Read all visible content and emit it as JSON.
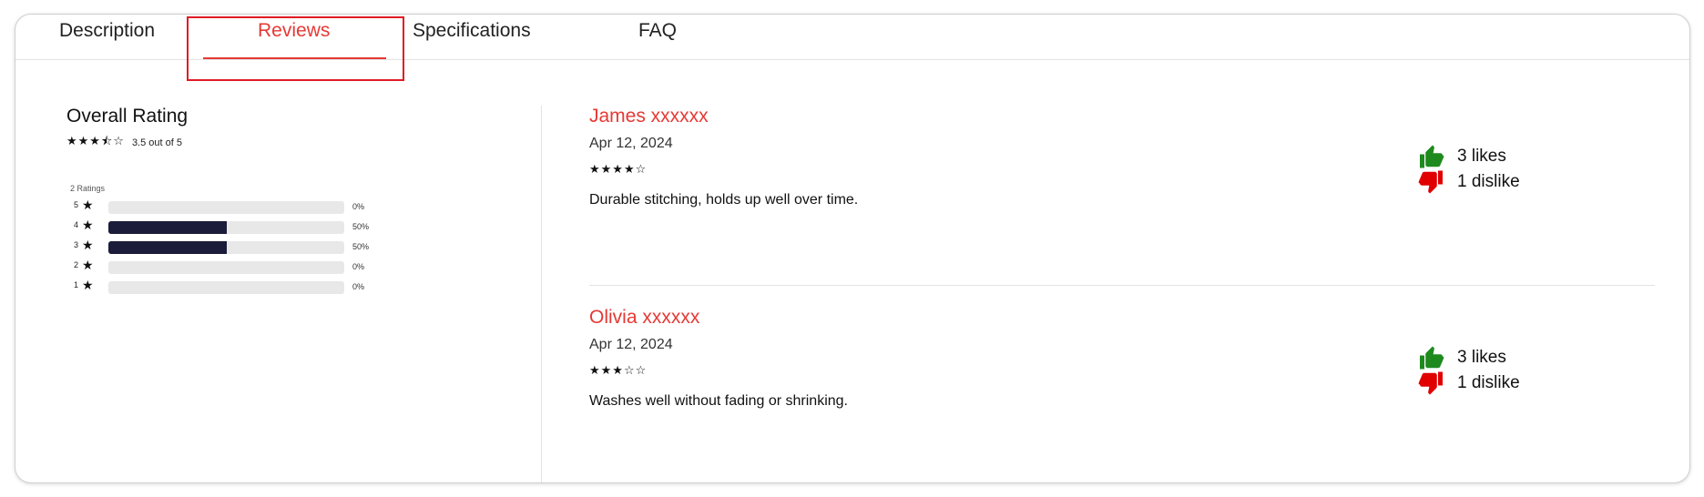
{
  "tabs": [
    {
      "label": "Description"
    },
    {
      "label": "Reviews",
      "active": true
    },
    {
      "label": "Specifications"
    },
    {
      "label": "FAQ"
    }
  ],
  "summary": {
    "title": "Overall Rating",
    "stars": "★★★⯪☆",
    "score_text": "3.5 out of 5",
    "ratings_count": "2 Ratings",
    "distribution": [
      {
        "label": "5",
        "percent": 0,
        "percent_text": "0%"
      },
      {
        "label": "4",
        "percent": 50,
        "percent_text": "50%"
      },
      {
        "label": "3",
        "percent": 50,
        "percent_text": "50%"
      },
      {
        "label": "2",
        "percent": 0,
        "percent_text": "0%"
      },
      {
        "label": "1",
        "percent": 0,
        "percent_text": "0%"
      }
    ]
  },
  "reviews": [
    {
      "name": "James xxxxxx",
      "date": "Apr 12, 2024",
      "stars": "★★★★☆",
      "text": "Durable stitching, holds up well over time.",
      "likes": "3 likes",
      "dislikes": "1 dislike"
    },
    {
      "name": "Olivia xxxxxx",
      "date": "Apr 12, 2024",
      "stars": "★★★☆☆",
      "text": "Washes well without fading or shrinking.",
      "likes": "3 likes",
      "dislikes": "1 dislike"
    }
  ],
  "colors": {
    "accent": "#e53935",
    "like": "#1e8a1e",
    "dislike": "#e00000",
    "bar": "#1b1b3a"
  }
}
